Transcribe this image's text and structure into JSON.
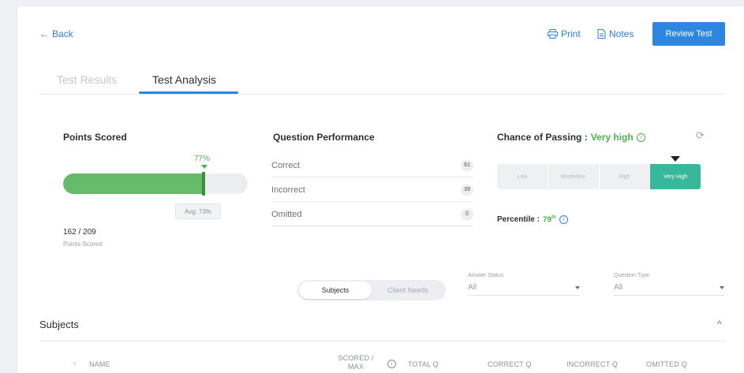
{
  "nav": {
    "back_label": "Back"
  },
  "toolbar": {
    "print_label": "Print",
    "notes_label": "Notes",
    "review_label": "Review Test"
  },
  "tabs": [
    {
      "label": "Test Results",
      "active": false
    },
    {
      "label": "Test Analysis",
      "active": true
    }
  ],
  "points": {
    "title": "Points Scored",
    "percent": 77,
    "percent_label": "77%",
    "avg_label": "Avg: 73%",
    "score": "162 / 209",
    "score_caption": "Points Scored"
  },
  "performance": {
    "title": "Question Performance",
    "rows": [
      {
        "label": "Correct",
        "count": "61"
      },
      {
        "label": "Incorrect",
        "count": "39"
      },
      {
        "label": "Omitted",
        "count": "0"
      }
    ]
  },
  "chance": {
    "label": "Chance of Passing :",
    "value": "Very high",
    "levels": [
      "Low",
      "Borderline",
      "High",
      "Very High"
    ],
    "active_level": "Very High",
    "percentile_label": "Percentile :",
    "percentile_value": "79"
  },
  "filters": {
    "toggle": [
      "Subjects",
      "Client Needs"
    ],
    "answer_status_label": "Answer Status",
    "answer_status_value": "All",
    "question_type_label": "Question Type",
    "question_type_value": "All"
  },
  "subjects": {
    "title": "Subjects",
    "columns": [
      "NAME",
      "SCORED / MAX",
      "TOTAL Q",
      "CORRECT Q",
      "INCORRECT Q",
      "OMITTED Q"
    ]
  },
  "colors": {
    "accent": "#2d86e0",
    "success": "#4caf50",
    "active_level": "#37b89a"
  }
}
